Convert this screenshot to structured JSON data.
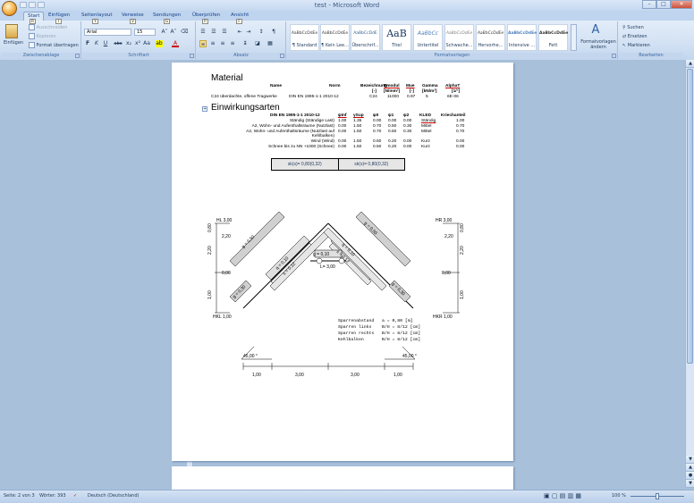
{
  "window": {
    "title": "test - Microsoft Word",
    "min": "–",
    "max": "□",
    "close": "✕"
  },
  "tabs": [
    {
      "label": "Start",
      "key": "R"
    },
    {
      "label": "Einfügen",
      "key": "I"
    },
    {
      "label": "Seitenlayout",
      "key": "Y"
    },
    {
      "label": "Verweise",
      "key": "V"
    },
    {
      "label": "Sendungen",
      "key": "G"
    },
    {
      "label": "Überprüfen",
      "key": "P"
    },
    {
      "label": "Ansicht",
      "key": "F"
    }
  ],
  "ribbon": {
    "clipboard": {
      "paste": "Einfügen",
      "cut": "Ausschneiden",
      "copy": "Kopieren",
      "format_painter": "Format übertragen",
      "label": "Zwischenablage"
    },
    "font": {
      "family": "Arial",
      "size": "15",
      "label": "Schriftart",
      "bold": "F",
      "italic": "K",
      "underline": "U",
      "strike": "abc",
      "sub": "x₂",
      "sup": "x²",
      "case": "Aa",
      "grow": "A˄",
      "shrink": "A˅",
      "clear": "⌫"
    },
    "paragraph": {
      "label": "Absatz",
      "marks": "¶"
    },
    "styles": {
      "label": "Formatvorlagen",
      "items": [
        {
          "prev": "AaBbCcDdEe",
          "name": "¶ Standard"
        },
        {
          "prev": "AaBbCcDdEe",
          "name": "¶ Kein Lee..."
        },
        {
          "prev": "AaBbCcDdE",
          "name": "Überschrif..."
        },
        {
          "prev": "AaB",
          "name": "Titel"
        },
        {
          "prev": "AaBbCc",
          "name": "Untertitel"
        },
        {
          "prev": "AaBbCcDdEe",
          "name": "Schwache..."
        },
        {
          "prev": "AaBbCcDdEe",
          "name": "Hervorhe..."
        },
        {
          "prev": "AaBbCcDdEe",
          "name": "Intensive ..."
        },
        {
          "prev": "AaBbCcDdEe",
          "name": "Fett"
        }
      ],
      "change": "Formatvorlagen ändern"
    },
    "editing": {
      "label": "Bearbeiten",
      "find": "Suchen",
      "replace": "Ersetzen",
      "select": "Markieren"
    }
  },
  "doc": {
    "material_heading": "Material",
    "mat_headers": [
      "Name",
      "Norm",
      "Bezeichnung",
      "Emodul",
      "Mue",
      "Gamma",
      "AlphaT"
    ],
    "mat_units": [
      "[-]",
      "[N/mm²]",
      "[-]",
      "[kN/m³]",
      "[1/°]"
    ],
    "mat_row": {
      "name": "C24 überdachte, offene Tragwerke",
      "norm": "DIN EN 1995-1-1 2010-12",
      "bez": "C24",
      "emodul": "11000",
      "mue": "0.97",
      "gamma": "5",
      "alpha": "6E-06"
    },
    "einw_heading": "Einwirkungsarten",
    "einw_headers": [
      "DIN EN 1995-1-1 2010-12",
      "ψInf",
      "γSup",
      "ψ0",
      "ψ1",
      "ψ2",
      "KLED",
      "Kriechanteil"
    ],
    "einw_rows": [
      {
        "name": "Ständig (Ständige Last)",
        "v": [
          "1.00",
          "1.35",
          "0.00",
          "0.00",
          "0.00"
        ],
        "kled": "Ständig",
        "kr": "1.00"
      },
      {
        "name": "A2, Wohn- und Aufenthaltsräume (Nutzlast)",
        "v": [
          "0.00",
          "1.50",
          "0.70",
          "0.50",
          "0.30"
        ],
        "kled": "Mittel",
        "kr": "0.70"
      },
      {
        "name": "A2, Wohn- und Aufenthaltsräume (Nutzlast auf",
        "v": [
          "0.00",
          "1.50",
          "0.70",
          "0.50",
          "0.30"
        ],
        "kled": "Mittel",
        "kr": "0.70"
      },
      {
        "name": "Kehlbalken)",
        "v": [
          "",
          "",
          "",
          "",
          ""
        ],
        "kled": "",
        "kr": ""
      },
      {
        "name": "Wind (Wind)",
        "v": [
          "0.00",
          "1.50",
          "0.60",
          "0.20",
          "0.00"
        ],
        "kled": "Kurz",
        "kr": "0.00"
      },
      {
        "name": "Schnee bis zu NN +1000 (Schnee)",
        "v": [
          "0.00",
          "1.50",
          "0.50",
          "0.20",
          "0.00"
        ],
        "kled": "Kurz",
        "kr": "0.00"
      }
    ],
    "sk": [
      "sk(s)= 0,80(0,32)",
      "sk(s)= 0,80(0,32)"
    ],
    "drawing": {
      "hl_top": "HL 3,00",
      "hr_top": "HR 3,00",
      "hkl": "HKL 1,00",
      "hkr": "HKR 1,00",
      "y220": "2,20",
      "y000": "0,00",
      "y080": "0,80",
      "y100": "1,00",
      "dim_l": "2,20",
      "dim_r": "2,20",
      "g_top": "g = 0,10",
      "le": "L= 3,00",
      "angle_l": "45,00 °",
      "angle_r": "45,00 °",
      "bottom_dims": [
        "1,00",
        "3,00",
        "3,00",
        "1,00"
      ],
      "loads_l": [
        "g = 0,50",
        "q = 0,10",
        "s = 0,12"
      ],
      "loads_r": [
        "g = 0,50",
        "q = 0,10",
        "s = 0,12"
      ],
      "kehl_l": "g = 0,30",
      "kehl_r": "g = 0,30"
    },
    "spec": [
      {
        "k": "Sparrenabstand",
        "v": "a = 0,80 [m]"
      },
      {
        "k": "Sparren links",
        "v": "B/H = 8/12 [cm]"
      },
      {
        "k": "Sparren rechts",
        "v": "B/H = 8/12 [cm]"
      },
      {
        "k": "Kehlbalken",
        "v": "B/H = 8/12 [cm]"
      }
    ]
  },
  "status": {
    "page": "Seite: 2 von 3",
    "words": "Wörter: 393",
    "lang": "Deutsch (Deutschland)",
    "zoom": "100 %"
  }
}
